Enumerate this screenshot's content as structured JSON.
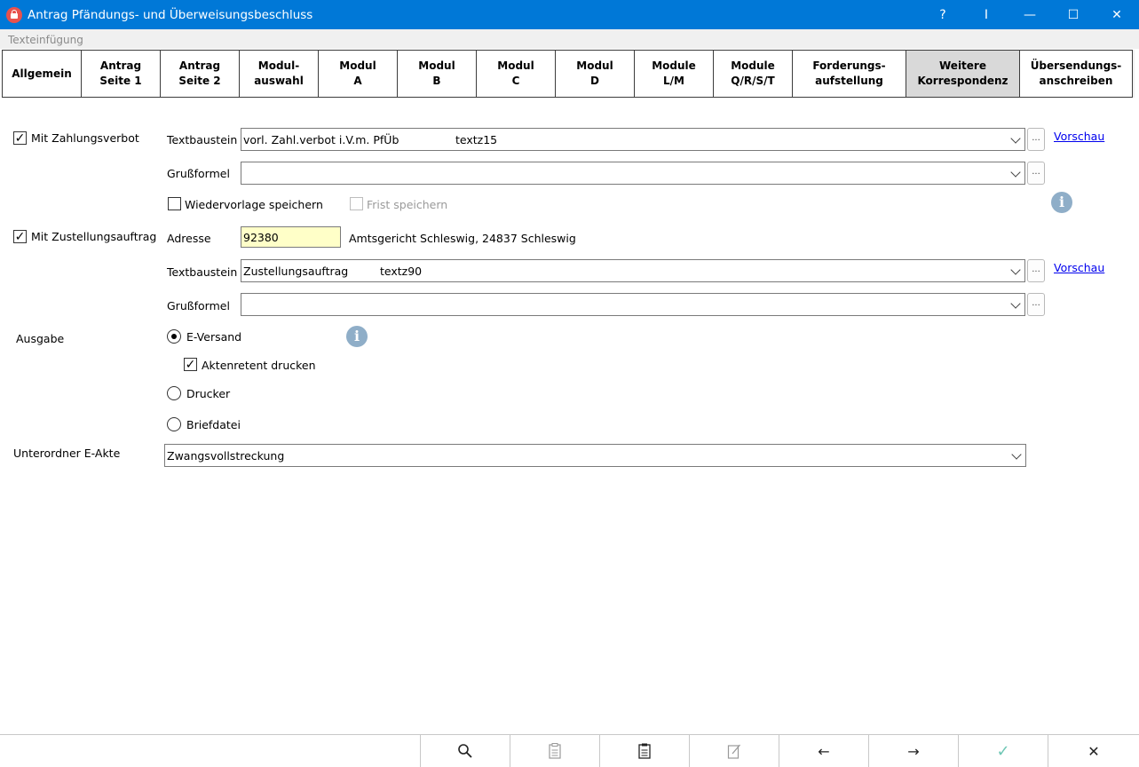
{
  "window": {
    "title": "Antrag Pfändungs- und Überweisungsbeschluss",
    "controls": [
      "?",
      "I",
      "—",
      "☐",
      "✕"
    ]
  },
  "menu": {
    "texteinfuegung": "Texteinfügung"
  },
  "tabs": [
    {
      "label": "Allgemein",
      "active": false
    },
    {
      "label": "Antrag\nSeite 1",
      "active": false
    },
    {
      "label": "Antrag\nSeite 2",
      "active": false
    },
    {
      "label": "Modul-\nauswahl",
      "active": false
    },
    {
      "label": "Modul\nA",
      "active": false
    },
    {
      "label": "Modul\nB",
      "active": false
    },
    {
      "label": "Modul\nC",
      "active": false
    },
    {
      "label": "Modul\nD",
      "active": false
    },
    {
      "label": "Module\nL/M",
      "active": false
    },
    {
      "label": "Module\nQ/R/S/T",
      "active": false
    },
    {
      "label": "Forderungs-\naufstellung",
      "active": false
    },
    {
      "label": "Weitere\nKorrespondenz",
      "active": true
    },
    {
      "label": "Übersendungs-\nanschreiben",
      "active": false
    }
  ],
  "zahlungsverbot": {
    "checkbox_label": "Mit Zahlungsverbot",
    "checked": true,
    "textbaustein_label": "Textbaustein",
    "textbaustein_value": "vorl. Zahl.verbot i.V.m. PfÜb                textz15",
    "grussformel_label": "Grußformel",
    "grussformel_value": "",
    "vorschau": "Vorschau",
    "wiedervorlage_label": "Wiedervorlage speichern",
    "wiedervorlage_checked": false,
    "frist_label": "Frist speichern",
    "frist_checked": false
  },
  "zustellungsauftrag": {
    "checkbox_label": "Mit Zustellungsauftrag",
    "checked": true,
    "adresse_label": "Adresse",
    "adresse_value": "92380",
    "adresse_text": "Amtsgericht Schleswig, 24837 Schleswig",
    "textbaustein_label": "Textbaustein",
    "textbaustein_value": "Zustellungsauftrag         textz90",
    "grussformel_label": "Grußformel",
    "grussformel_value": "",
    "vorschau": "Vorschau"
  },
  "ausgabe": {
    "label": "Ausgabe",
    "options": [
      {
        "label": "E-Versand",
        "selected": true
      },
      {
        "label": "Drucker",
        "selected": false
      },
      {
        "label": "Briefdatei",
        "selected": false
      }
    ],
    "aktenretent_label": "Aktenretent drucken",
    "aktenretent_checked": true
  },
  "unterordner": {
    "label": "Unterordner E-Akte",
    "value": "Zwangsvollstreckung"
  },
  "bottom_buttons": [
    {
      "icon": "search-icon",
      "glyph": "🔍︎"
    },
    {
      "icon": "document-clipboard-icon",
      "glyph": "🗐"
    },
    {
      "icon": "document-list-icon",
      "glyph": "🗎"
    },
    {
      "icon": "document-edit-icon",
      "glyph": "✎"
    },
    {
      "icon": "arrow-left-icon",
      "glyph": "←"
    },
    {
      "icon": "arrow-right-icon",
      "glyph": "→"
    },
    {
      "icon": "checkmark-icon",
      "glyph": "✓"
    },
    {
      "icon": "close-icon",
      "glyph": "✕"
    }
  ],
  "colors": {
    "titlebar": "#0078d7",
    "input_highlight": "#ffffc8",
    "info_icon": "#8faec8",
    "link": "#0000ee"
  }
}
